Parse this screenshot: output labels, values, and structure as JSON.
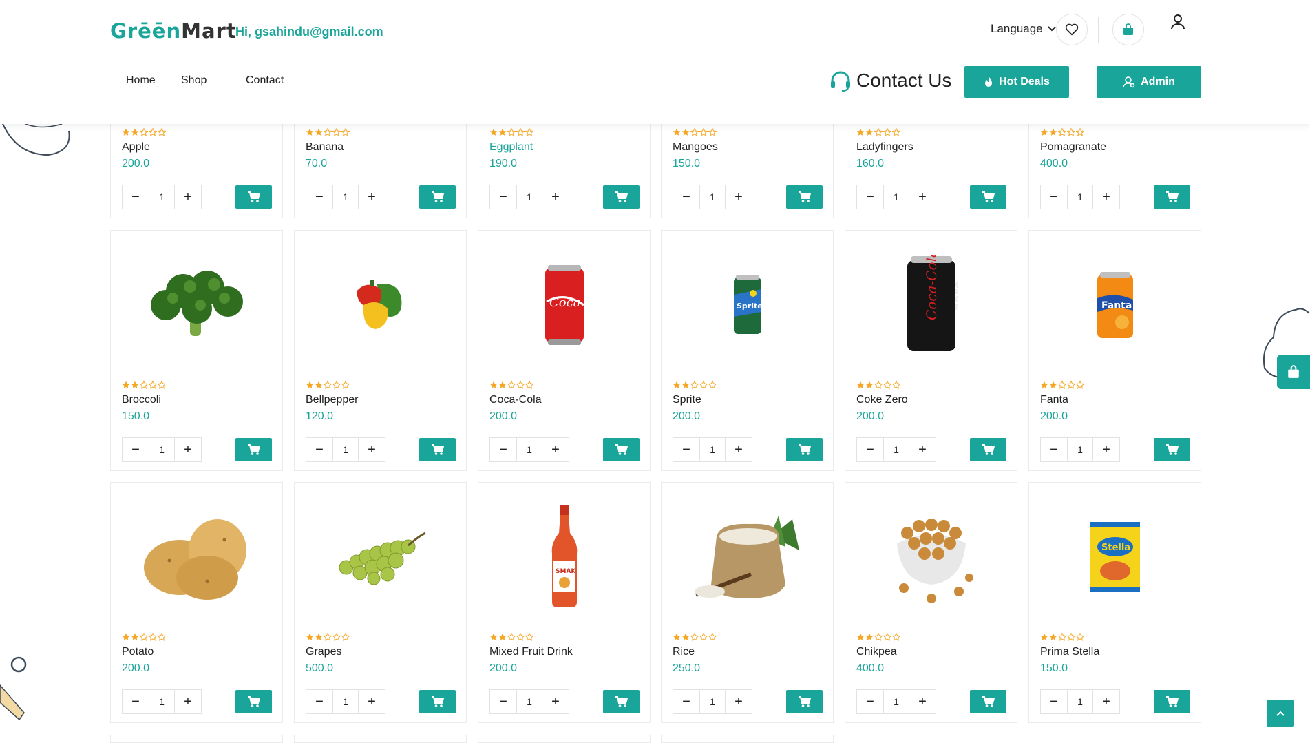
{
  "header": {
    "logo_green": "Grēēn",
    "logo_dark": "Mart",
    "greeting": "Hi, gsahindu@gmail.com",
    "language_label": "Language",
    "contact_us": "Contact Us",
    "hot_deals": "Hot Deals",
    "admin": "Admin"
  },
  "nav": {
    "home": "Home",
    "shop": "Shop",
    "contact": "Contact"
  },
  "colors": {
    "accent": "#1aa59a",
    "star": "#f5a623"
  },
  "products": [
    {
      "name": "Apple",
      "price": "200.0",
      "qty": "1",
      "rating": 2,
      "icon": "apple"
    },
    {
      "name": "Banana",
      "price": "70.0",
      "qty": "1",
      "rating": 2,
      "icon": "banana"
    },
    {
      "name": "Eggplant",
      "price": "190.0",
      "qty": "1",
      "rating": 2,
      "icon": "eggplant"
    },
    {
      "name": "Mangoes",
      "price": "150.0",
      "qty": "1",
      "rating": 2,
      "icon": "mango"
    },
    {
      "name": "Ladyfingers",
      "price": "160.0",
      "qty": "1",
      "rating": 2,
      "icon": "okra"
    },
    {
      "name": "Pomagranate",
      "price": "400.0",
      "qty": "1",
      "rating": 2,
      "icon": "pomegranate"
    },
    {
      "name": "Broccoli",
      "price": "150.0",
      "qty": "1",
      "rating": 2,
      "icon": "broccoli"
    },
    {
      "name": "Bellpepper",
      "price": "120.0",
      "qty": "1",
      "rating": 2,
      "icon": "bellpepper"
    },
    {
      "name": "Coca-Cola",
      "price": "200.0",
      "qty": "1",
      "rating": 2,
      "icon": "coca-cola-can"
    },
    {
      "name": "Sprite",
      "price": "200.0",
      "qty": "1",
      "rating": 2,
      "icon": "sprite-can"
    },
    {
      "name": "Coke Zero",
      "price": "200.0",
      "qty": "1",
      "rating": 2,
      "icon": "coke-zero-can"
    },
    {
      "name": "Fanta",
      "price": "200.0",
      "qty": "1",
      "rating": 2,
      "icon": "fanta-can"
    },
    {
      "name": "Potato",
      "price": "200.0",
      "qty": "1",
      "rating": 2,
      "icon": "potato"
    },
    {
      "name": "Grapes",
      "price": "500.0",
      "qty": "1",
      "rating": 2,
      "icon": "grapes"
    },
    {
      "name": "Mixed Fruit Drink",
      "price": "200.0",
      "qty": "1",
      "rating": 2,
      "icon": "bottle"
    },
    {
      "name": "Rice",
      "price": "250.0",
      "qty": "1",
      "rating": 2,
      "icon": "rice-sack"
    },
    {
      "name": "Chikpea",
      "price": "400.0",
      "qty": "1",
      "rating": 2,
      "icon": "chickpea-bowl"
    },
    {
      "name": "Prima Stella",
      "price": "150.0",
      "qty": "1",
      "rating": 2,
      "icon": "snack-pack"
    }
  ]
}
